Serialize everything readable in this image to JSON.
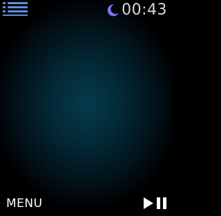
{
  "status_bar": {
    "time": "00:43",
    "do_not_disturb_icon": "moon-icon",
    "list_icon": "list-icon"
  },
  "bottom_bar": {
    "menu_label": "MENU",
    "play_pause_icon": "play-pause-icon"
  },
  "colors": {
    "accent": "#5b8fe0",
    "moon": "#7d77ee",
    "time_text": "#d7d7d7",
    "background_center": "#053a4c"
  }
}
